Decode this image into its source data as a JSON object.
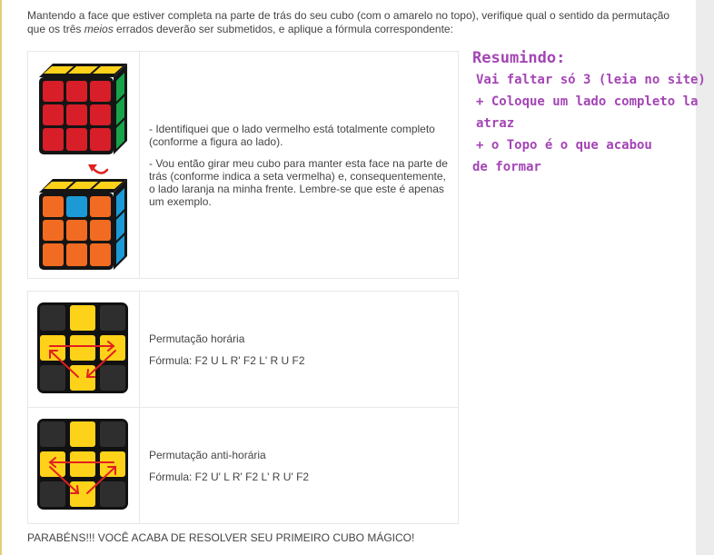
{
  "intro": {
    "part1": "Mantendo a face que estiver completa na parte de trás do seu cubo (com o amarelo no topo), verifique qual o sentido da permutação que os três ",
    "em": "meios",
    "part2": " errados deverão ser submetidos, e aplique a fórmula correspondente:"
  },
  "step": {
    "para1": "- Identifiquei que o lado vermelho está totalmente completo (conforme a figura ao lado).",
    "para2": "- Vou então girar meu cubo para manter esta face na parte de trás (conforme indica a seta vermelha) e, consequentemente, o lado laranja na minha frente. Lembre-se que este é apenas um exemplo."
  },
  "permutations": [
    {
      "title": "Permutação horária",
      "formula": "Fórmula: F2 U L R' F2 L' R U F2"
    },
    {
      "title": "Permutação anti-horária",
      "formula": "Fórmula: F2 U' L R' F2 L' R U' F2"
    }
  ],
  "note": {
    "heading": "Resumindo:",
    "lines": [
      "Vai faltar só 3 (leia no site)",
      "+ Coloque um lado completo la",
      "atraz",
      "+ o Topo é o que acabou",
      "de formar"
    ]
  },
  "footer": "PARABÉNS!!! VOCÊ ACABA DE RESOLVER SEU PRIMEIRO CUBO MÁGICO!",
  "colors": {
    "note": "#a445b5",
    "cube_yellow": "#ffd21a",
    "cube_red": "#d81e28",
    "cube_green": "#16a34a",
    "cube_orange": "#f26b22",
    "cube_blue": "#1c9ad6",
    "arrow": "#e02020"
  }
}
